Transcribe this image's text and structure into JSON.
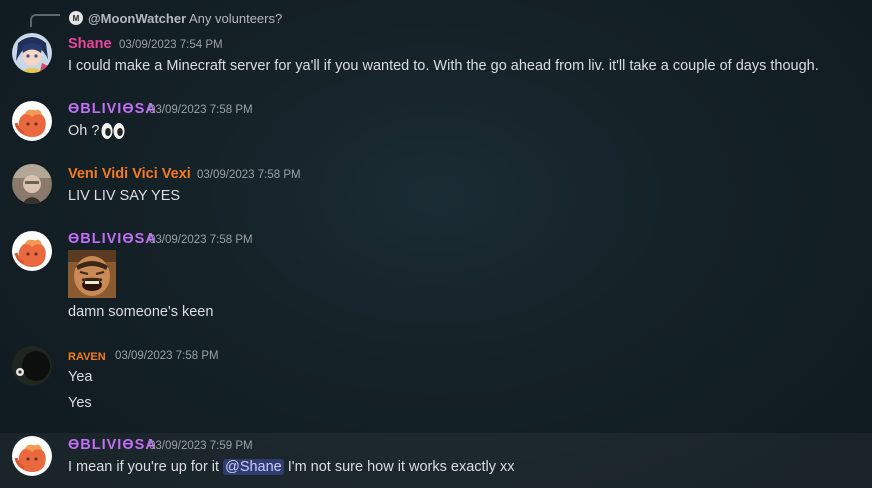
{
  "reply": {
    "avatar_letter": "M",
    "name": "@MoonWatcher",
    "text": "Any volunteers?"
  },
  "colors": {
    "shane": "#eb459e",
    "obliviosa": "#c06ff5",
    "veni": "#f47b20",
    "raven": "#f47b20",
    "mention_bg": "#3e4580"
  },
  "messages": [
    {
      "author": "Shane",
      "time": "03/09/2023 7:54 PM",
      "lines": [
        "I could make a Minecraft server for ya'll if you wanted to. With the go ahead from liv. it'll take a couple of days though."
      ]
    },
    {
      "author": "ƟBLIVIƟSA",
      "time": "03/09/2023 7:58 PM",
      "lines": [
        "Oh ?"
      ],
      "emoji": "eyes-emoji"
    },
    {
      "author": "Veni Vidi Vici Vexi",
      "time": "03/09/2023 7:58 PM",
      "lines": [
        "LIV LIV SAY YES"
      ]
    },
    {
      "author": "ƟBLIVIƟSA",
      "time": "03/09/2023 7:58 PM",
      "lines": [
        "damn someone's keen"
      ],
      "image": "laughing-man-emote"
    },
    {
      "author": "RAVEN",
      "time": "03/09/2023 7:58 PM",
      "lines": [
        "Yea",
        "Yes"
      ]
    },
    {
      "author": "ƟBLIVIƟSA",
      "time": "03/09/2023 7:59 PM",
      "before_mention": "I mean if you're up for it ",
      "mention": "@Shane",
      "after_mention": " I'm not sure how it works exactly xx"
    }
  ]
}
